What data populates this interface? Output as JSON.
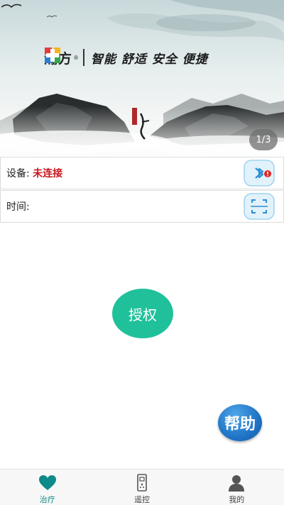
{
  "banner": {
    "brand_name": "瀚方",
    "brand_reg": "®",
    "slogan": "智能 舒适 安全 便捷",
    "page_indicator": "1/3"
  },
  "device_row": {
    "label": "设备:",
    "status": "未连接",
    "status_color": "#c8161d",
    "icon": "bluetooth-icon"
  },
  "time_row": {
    "label": "时间:",
    "value": "",
    "icon": "scan-icon"
  },
  "auth_button": {
    "label": "授权",
    "color": "#20c19a"
  },
  "help_button": {
    "label": "帮助",
    "color": "#1f74c6"
  },
  "tabbar": {
    "items": [
      {
        "label": "治疗",
        "icon": "heart-icon",
        "active": true
      },
      {
        "label": "遥控",
        "icon": "remote-icon",
        "active": false
      },
      {
        "label": "我的",
        "icon": "person-icon",
        "active": false
      }
    ]
  }
}
